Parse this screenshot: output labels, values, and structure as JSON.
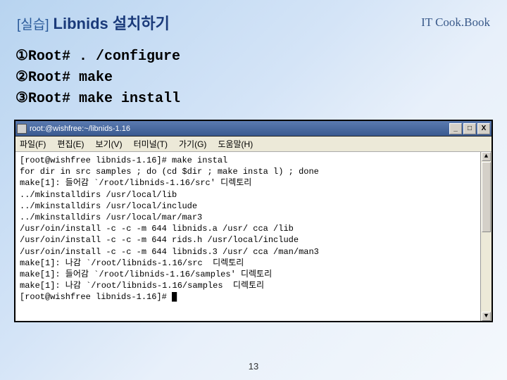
{
  "header": {
    "prefix": "[실습]",
    "title": "Libnids 설치하기",
    "brand": "IT Cook.Book"
  },
  "steps": {
    "line1": "①Root# . /configure",
    "line2": "②Root# make",
    "line3": "③Root# make install"
  },
  "terminal": {
    "titlebar": "root:@wishfree:~/libnids-1.16",
    "buttons": {
      "min": "_",
      "max": "□",
      "close": "X"
    },
    "menu": {
      "file": "파일(F)",
      "edit": "편집(E)",
      "view": "보기(V)",
      "terminal": "터미널(T)",
      "go": "가기(G)",
      "help": "도움말(H)"
    },
    "body": "[root@wishfree libnids-1.16]# make instal\nfor dir in src samples ; do (cd $dir ; make insta l) ; done\nmake[1]: 들어감 `/root/libnids-1.16/src' 디렉토리\n../mkinstalldirs /usr/local/lib\n../mkinstalldirs /usr/local/include\n../mkinstalldirs /usr/local/mar/mar3\n/usr/oin/install -c -c -m 644 libnids.a /usr/ cca /lib\n/usr/oin/install -c -c -m 644 rids.h /usr/local/include\n/usr/oin/install -c -c -m 644 libnids.3 /usr/ cca /man/man3\nmake[1]: 나감 `/root/libnids-1.16/src  디렉토리\nmake[1]: 들어감 `/root/libnids-1.16/samples' 디렉토리\nmake[1]: 나감 `/root/libnids-1.16/samples  디렉토리\n[root@wishfree libnids-1.16]# █"
  },
  "page_number": "13"
}
